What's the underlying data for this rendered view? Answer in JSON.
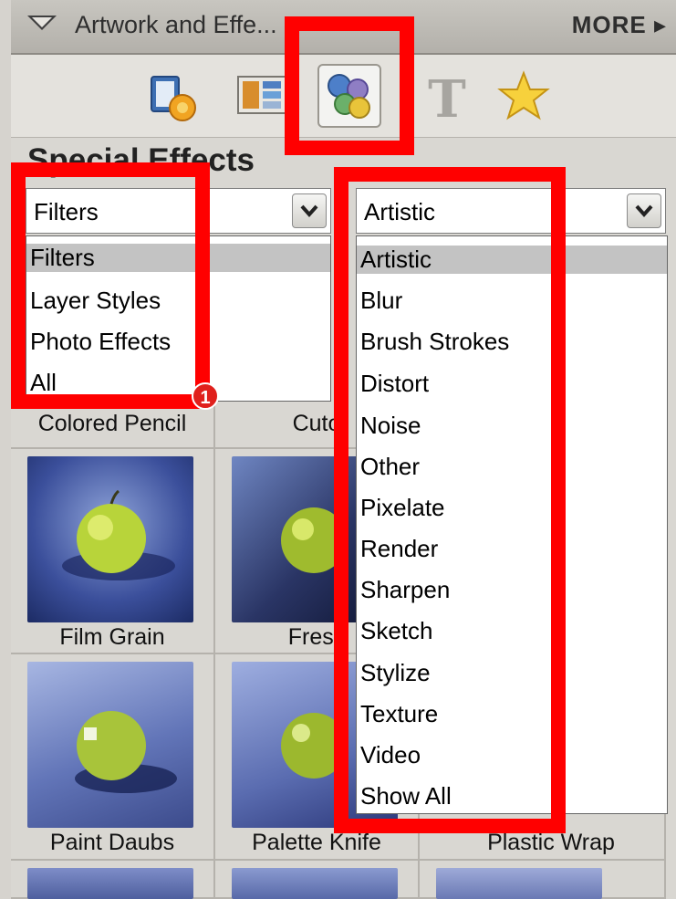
{
  "panel": {
    "title": "Artwork and Effe...",
    "more_label": "MORE ▸"
  },
  "toolbar": {
    "icons": [
      "frames-icon",
      "themes-icon",
      "effects-icon",
      "text-icon",
      "favorites-icon"
    ],
    "selected_index": 2
  },
  "section": {
    "title": "Special Effects"
  },
  "type_dropdown": {
    "selected": "Filters",
    "options": [
      "Filters",
      "Layer Styles",
      "Photo Effects",
      "All"
    ]
  },
  "category_dropdown": {
    "selected": "Artistic",
    "options": [
      "Artistic",
      "Blur",
      "Brush Strokes",
      "Distort",
      "Noise",
      "Other",
      "Pixelate",
      "Render",
      "Sharpen",
      "Sketch",
      "Stylize",
      "Texture",
      "Video",
      "Show All"
    ]
  },
  "thumbnails": {
    "row0": [
      "Colored Pencil",
      "Cuto",
      ""
    ],
    "row1": [
      "Film Grain",
      "Fresc",
      ""
    ],
    "row2": [
      "Paint Daubs",
      "Palette Knife",
      "Plastic Wrap"
    ]
  },
  "callout": {
    "number": "1"
  },
  "colors": {
    "highlight_red": "#ff0000",
    "selection_gray": "#c3c3c3"
  }
}
